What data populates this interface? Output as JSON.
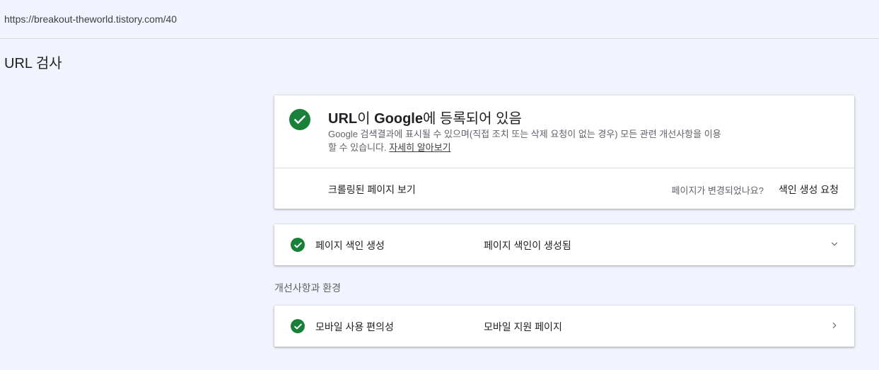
{
  "url_bar": {
    "url": "https://breakout-theworld.tistory.com/40"
  },
  "page": {
    "title": "URL 검사"
  },
  "status_card": {
    "title_parts": [
      "URL",
      "이 ",
      "Google",
      "에 등록되어 있음"
    ],
    "description": "Google 검색결과에 표시될 수 있으며(직접 조치 또는 삭제 요청이 없는 경우) 모든 관련 개선사항을 이용할 수 있습니다. ",
    "learn_more": "자세히 알아보기",
    "view_crawled": "크롤링된 페이지 보기",
    "changed_question": "페이지가 변경되었나요?",
    "request_indexing": "색인 생성 요청"
  },
  "coverage": {
    "label": "페이지 색인 생성",
    "value": "페이지 색인이 생성됨"
  },
  "enhancements": {
    "header": "개선사항과 환경",
    "mobile": {
      "label": "모바일 사용 편의성",
      "value": "모바일 지원 페이지"
    }
  },
  "colors": {
    "success": "#188038",
    "background": "#f1f4fc"
  },
  "icons": {
    "status": "check-circle-icon",
    "expand": "chevron-down-icon",
    "navigate": "chevron-right-icon"
  }
}
